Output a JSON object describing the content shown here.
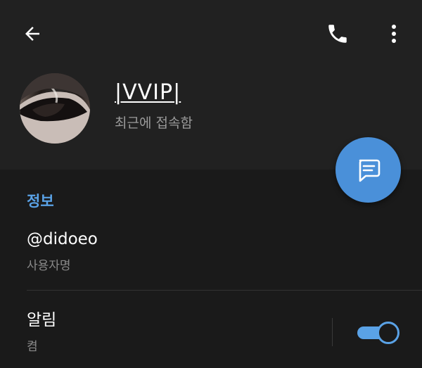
{
  "header": {
    "title": "|VVIP|",
    "status": "최근에 접속함"
  },
  "icons": {
    "back": "back-arrow-icon",
    "call": "phone-icon",
    "more": "more-vert-icon",
    "message": "message-icon"
  },
  "info": {
    "section_title": "정보",
    "username": "@didoeo",
    "username_label": "사용자명",
    "notifications_label": "알림",
    "notifications_state": "켬",
    "notifications_on": true
  },
  "colors": {
    "accent": "#5aa2e6",
    "fab": "#4a90d9",
    "background": "#1a1a1a",
    "header": "#212121"
  }
}
